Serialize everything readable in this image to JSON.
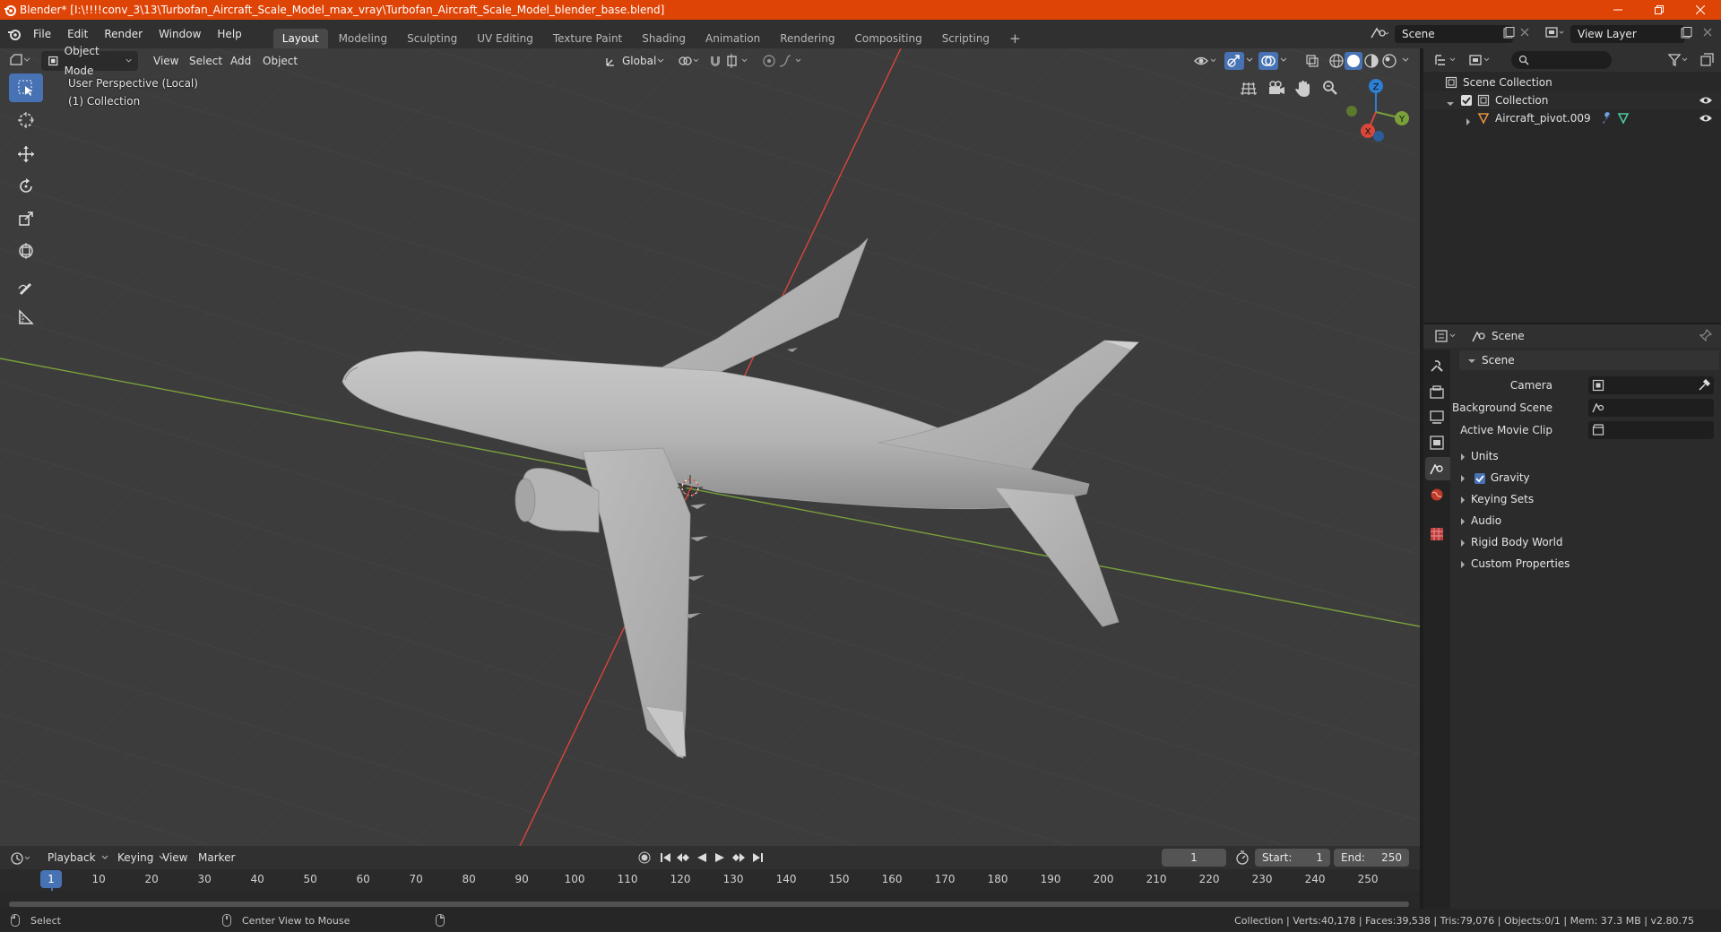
{
  "window": {
    "title": "Blender* [I:\\!!!!conv_3\\13\\Turbofan_Aircraft_Scale_Model_max_vray\\Turbofan_Aircraft_Scale_Model_blender_base.blend]"
  },
  "menu": {
    "items": [
      "File",
      "Edit",
      "Render",
      "Window",
      "Help"
    ]
  },
  "workspaces": {
    "tabs": [
      "Layout",
      "Modeling",
      "Sculpting",
      "UV Editing",
      "Texture Paint",
      "Shading",
      "Animation",
      "Rendering",
      "Compositing",
      "Scripting"
    ],
    "active": "Layout",
    "add_label": "+"
  },
  "scene_selector": {
    "value": "Scene"
  },
  "view_layer_selector": {
    "value": "View Layer"
  },
  "viewport_header": {
    "mode": "Object Mode",
    "menus": [
      "View",
      "Select",
      "Add",
      "Object"
    ],
    "orientation": "Global"
  },
  "viewport": {
    "perspective_label": "User Perspective (Local)",
    "collection_label": "(1) Collection",
    "gizmo": {
      "x": "X",
      "y": "Y",
      "z": "Z"
    },
    "colors": {
      "x_axis": "#d9463a",
      "y_axis": "#7aa03a",
      "z_axis": "#2d7fd3",
      "background": "#3c3c3c"
    }
  },
  "outliner": {
    "root": "Scene Collection",
    "collection": "Collection",
    "object": "Aircraft_pivot.009"
  },
  "properties": {
    "header": "Scene",
    "panel_title": "Scene",
    "fields": [
      {
        "label": "Camera"
      },
      {
        "label": "Background Scene"
      },
      {
        "label": "Active Movie Clip"
      }
    ],
    "sections": [
      {
        "label": "Units",
        "has_checkbox": false
      },
      {
        "label": "Gravity",
        "has_checkbox": true,
        "checked": true
      },
      {
        "label": "Keying Sets",
        "has_checkbox": false
      },
      {
        "label": "Audio",
        "has_checkbox": false
      },
      {
        "label": "Rigid Body World",
        "has_checkbox": false
      },
      {
        "label": "Custom Properties",
        "has_checkbox": false
      }
    ]
  },
  "timeline": {
    "menus": [
      "Playback",
      "Keying",
      "View",
      "Marker"
    ],
    "current_frame": "1",
    "start_label": "Start:",
    "start": "1",
    "end_label": "End:",
    "end": "250",
    "frame_marks": [
      "10",
      "20",
      "30",
      "40",
      "50",
      "60",
      "70",
      "80",
      "90",
      "100",
      "110",
      "120",
      "130",
      "140",
      "150",
      "160",
      "170",
      "180",
      "190",
      "200",
      "210",
      "220",
      "230",
      "240",
      "250"
    ],
    "playhead": "1"
  },
  "statusbar": {
    "left_action": "Select",
    "middle_action": "Center View to Mouse",
    "stats": "Collection | Verts:40,178 | Faces:39,538 | Tris:79,076 | Objects:0/1 | Mem: 37.3 MB | v2.80.75"
  }
}
